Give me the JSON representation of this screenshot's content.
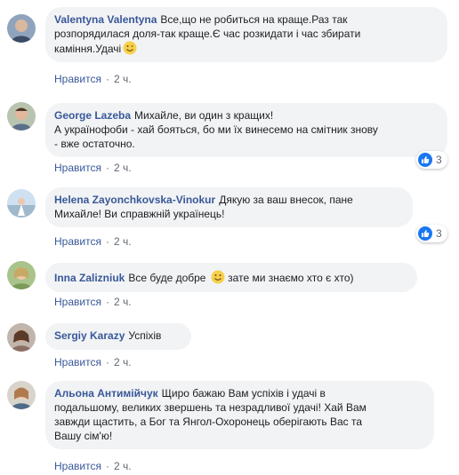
{
  "comments": [
    {
      "author": "Valentyna Valentyna",
      "text": "Все,що не робиться на краще.Раз так\nрозпорядилася доля-так краще.Є час розкидати і час збирати\nкаміння.Удачі",
      "emoji": "wink-emoji",
      "like_label": "Нравится",
      "time": "2 ч."
    },
    {
      "author": "George Lazeba",
      "text": "Михайле, ви один з кращих!\nА українофоби - хай бояться, бо ми їх винесемо на смітник знову\n- вже остаточно.",
      "like_label": "Нравится",
      "time": "2 ч.",
      "reactions": "3"
    },
    {
      "author": "Helena Zayonchkovska-Vinokur",
      "text": "Дякую за ваш внесок, пане\nМихайле! Ви справжній українець!",
      "like_label": "Нравится",
      "time": "2 ч.",
      "reactions": "3"
    },
    {
      "author": "Inna Zalizniuk",
      "text_before": "Все буде добре",
      "emoji": "smile-emoji",
      "text_after": "зате ми знаємо хто є хто)",
      "like_label": "Нравится",
      "time": "2 ч."
    },
    {
      "author": "Sergiy Karazy",
      "text": "Успіхів",
      "like_label": "Нравится",
      "time": "2 ч."
    },
    {
      "author": "Альона Антимійчук",
      "text": "Щиро бажаю Вам успіхів і удачі в\nподальшому, великих звершень та незрадливої удачі! Хай Вам\nзавжди щастить, а Бог та Янгол-Охоронець оберігають Вас та\nВашу сім'ю!",
      "like_label": "Нравится",
      "time": "2 ч."
    }
  ],
  "separator": "·",
  "colors": {
    "author": "#385898",
    "bubble": "#f2f3f5",
    "like_blue": "#1877f2"
  }
}
